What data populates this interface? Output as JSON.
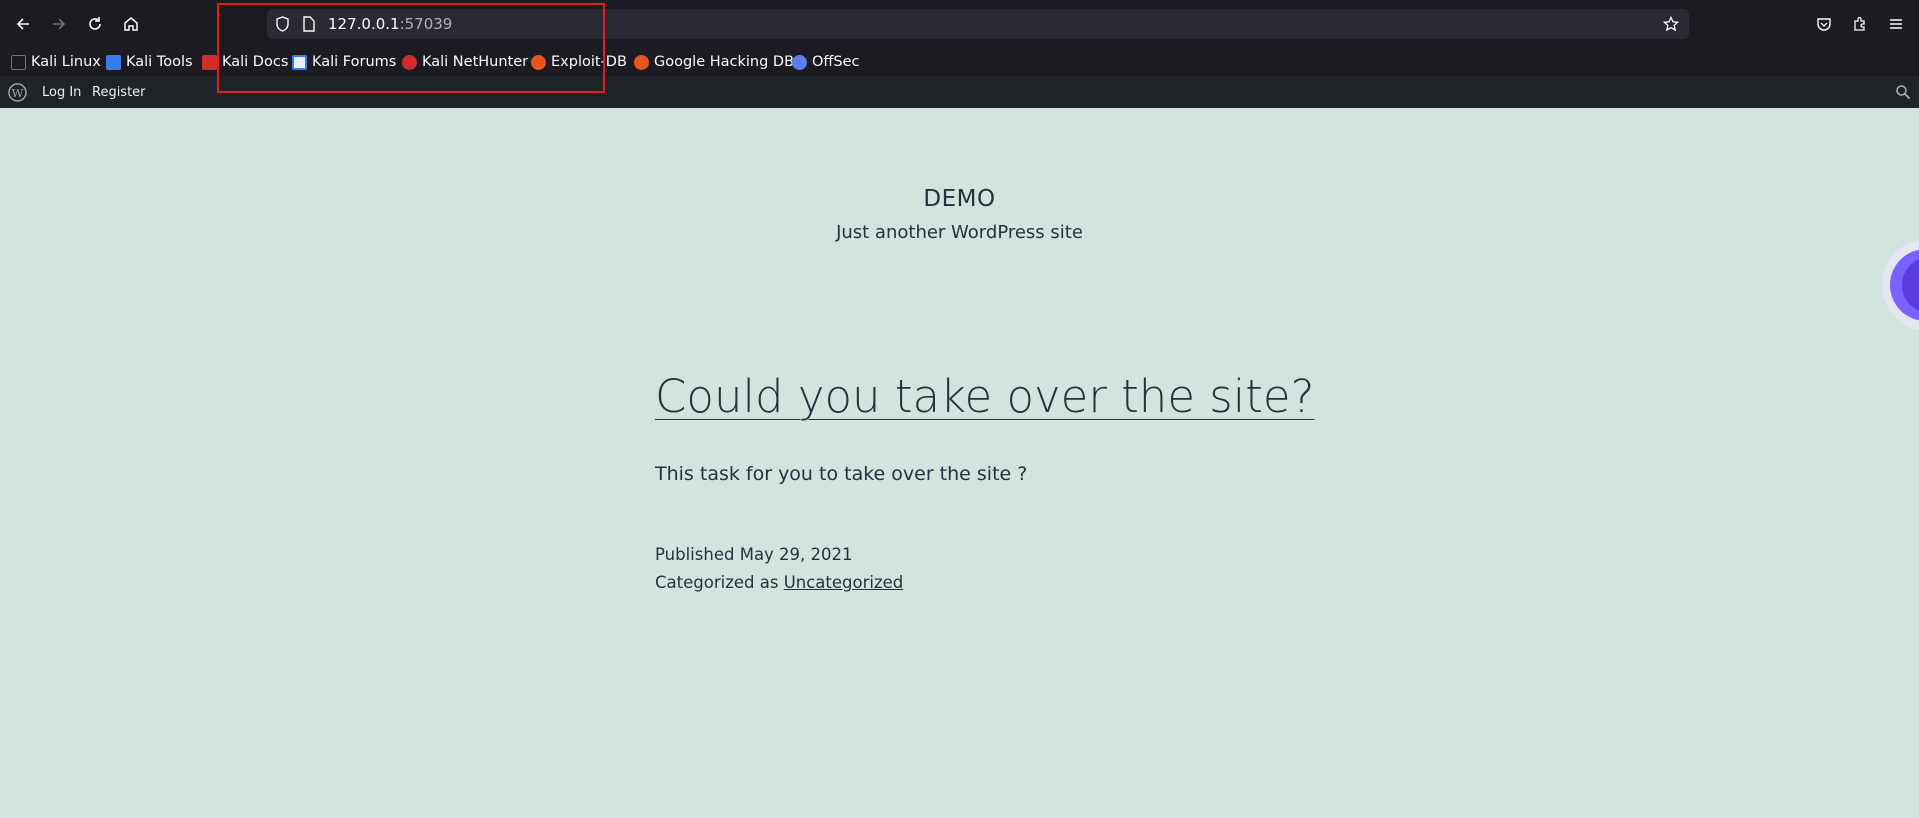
{
  "browser": {
    "url_host": "127.0.0.1",
    "url_port": ":57039",
    "icons": [
      "back-icon",
      "forward-icon",
      "reload-icon",
      "home-icon",
      "shield-icon",
      "page-icon",
      "star-icon",
      "pocket-icon",
      "extensions-icon",
      "menu-icon"
    ]
  },
  "bookmarks": [
    {
      "label": "Kali Linux",
      "color": "#367bf0"
    },
    {
      "label": "Kali Tools",
      "color": "#367bf0"
    },
    {
      "label": "Kali Docs",
      "color": "#d22b2b"
    },
    {
      "label": "Kali Forums",
      "color": "#367bf0"
    },
    {
      "label": "Kali NetHunter",
      "color": "#d22b2b"
    },
    {
      "label": "Exploit-DB",
      "color": "#e8541e"
    },
    {
      "label": "Google Hacking DB",
      "color": "#e8541e"
    },
    {
      "label": "OffSec",
      "color": "#5b7cf7"
    }
  ],
  "adminbar": {
    "login": "Log In",
    "register": "Register"
  },
  "site": {
    "title": "DEMO",
    "description": "Just another WordPress site"
  },
  "post": {
    "title": "Could you take over the site?",
    "body": "This task for you to take over the site ?",
    "published_prefix": "Published",
    "published_date": "May 29, 2021",
    "category_prefix": "Categorized as",
    "category": "Uncategorized"
  },
  "colors": {
    "page_bg": "#d1e4dd",
    "text": "#28303d",
    "highlight": "#e0201c"
  }
}
